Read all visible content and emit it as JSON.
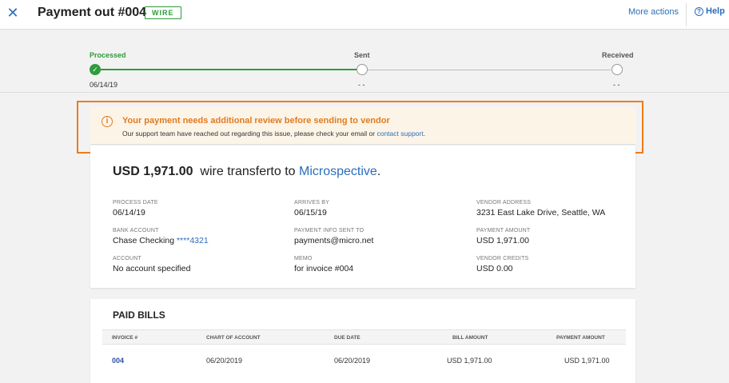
{
  "header": {
    "close_icon": "close-icon",
    "title": "Payment out #004",
    "badge": "WIRE",
    "more_actions": "More actions",
    "help_icon": "help-icon",
    "help": "Help"
  },
  "progress": {
    "steps": [
      {
        "label": "Processed",
        "date": "06/14/19",
        "state": "done"
      },
      {
        "label": "Sent",
        "date": "- -",
        "state": "pending"
      },
      {
        "label": "Received",
        "date": "- -",
        "state": "pending"
      }
    ]
  },
  "alert": {
    "icon": "info-icon",
    "title": "Your payment needs additional review before sending to vendor",
    "text": "Our support team have reached out regarding this issue, please check your email or",
    "link": "contact support",
    "end": "."
  },
  "detail": {
    "amount": "USD 1,971.00",
    "method_text": "wire transferto to",
    "vendor": "Microspective",
    "period": ".",
    "fields": {
      "process_date": {
        "label": "PROCESS DATE",
        "value": "06/14/19"
      },
      "arrives_by": {
        "label": "ARRIVES BY",
        "value": "06/15/19"
      },
      "vendor_address": {
        "label": "VENDOR ADDRESS",
        "value": "3231 East Lake Drive, Seattle, WA"
      },
      "bank_account": {
        "label": "BANK ACCOUNT",
        "value": "Chase Checking",
        "masked": "****4321"
      },
      "payment_info": {
        "label": "PAYMENT INFO SENT TO",
        "value": "payments@micro.net"
      },
      "payment_amount": {
        "label": "PAYMENT AMOUNT",
        "value": "USD 1,971.00"
      },
      "account": {
        "label": "ACCOUNT",
        "value": "No account specified"
      },
      "memo": {
        "label": "MEMO",
        "value": "for invoice #004"
      },
      "vendor_credits": {
        "label": "VENDOR CREDITS",
        "value": "USD 0.00"
      }
    }
  },
  "bills": {
    "title": "PAID BILLS",
    "columns": [
      "INVOICE #",
      "CHART OF ACCOUNT",
      "DUE DATE",
      "BILL AMOUNT",
      "PAYMENT AMOUNT"
    ],
    "rows": [
      {
        "invoice": "004",
        "chart_of_account": "06/20/2019",
        "due_date": "06/20/2019",
        "bill_amount": "USD 1,971.00",
        "payment_amount": "USD 1,971.00"
      }
    ]
  },
  "colors": {
    "accent_blue": "#2a6ebb",
    "success_green": "#2e9c3a",
    "warning_orange": "#e07b1e",
    "highlight_orange": "#f07b18"
  }
}
